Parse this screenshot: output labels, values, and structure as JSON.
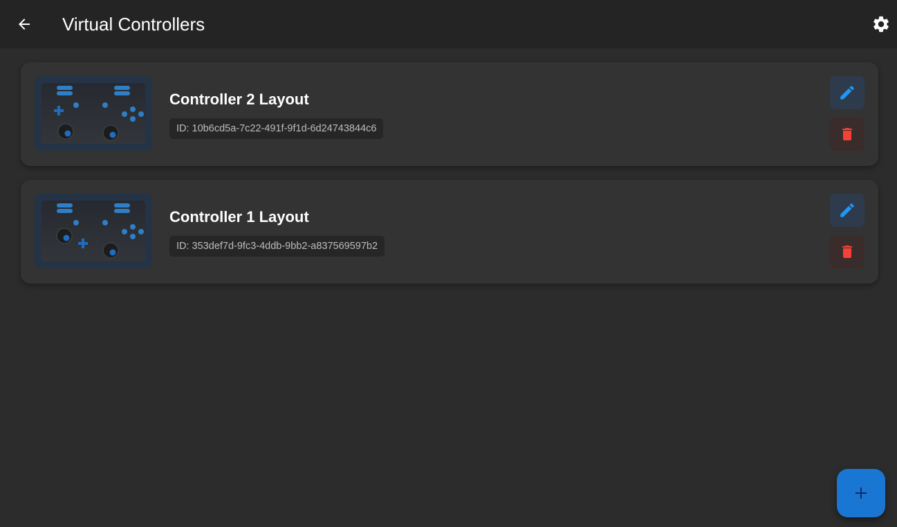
{
  "appbar": {
    "title": "Virtual Controllers",
    "back_icon": "arrow-back-icon",
    "settings_icon": "gear-icon"
  },
  "controllers": [
    {
      "title": "Controller 2 Layout",
      "id_text": "ID: 10b6cd5a-7c22-491f-9f1d-6d24743844c6"
    },
    {
      "title": "Controller 1 Layout",
      "id_text": "ID: 353def7d-9fc3-4ddb-9bb2-a837569597b2"
    }
  ],
  "actions": {
    "edit_icon": "pencil-icon",
    "delete_icon": "trash-icon",
    "add_icon": "plus-icon"
  },
  "colors": {
    "background": "#2c2c2c",
    "appbar": "#242424",
    "card": "#333333",
    "accent": "#1976d2",
    "edit_icon": "#2196f3",
    "delete_icon": "#f44336"
  }
}
